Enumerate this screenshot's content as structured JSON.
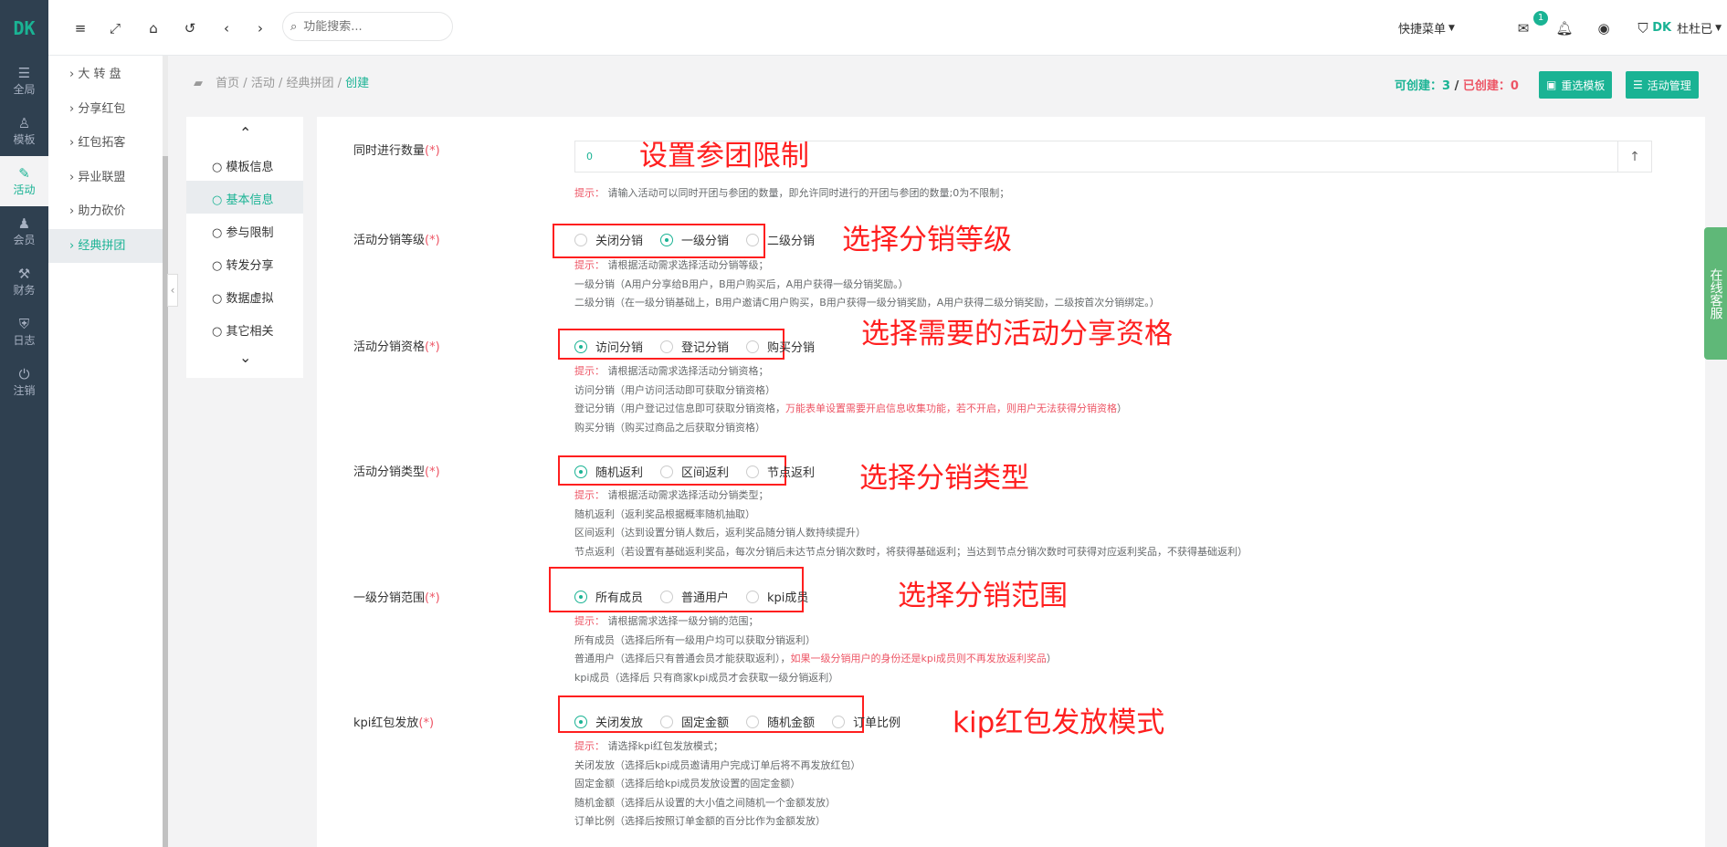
{
  "brand": {
    "logo": "DK",
    "accent": "#1ab394"
  },
  "rail": [
    {
      "label": "全局",
      "icon": "sliders-icon"
    },
    {
      "label": "模板",
      "icon": "sitemap-icon"
    },
    {
      "label": "活动",
      "icon": "pen-icon"
    },
    {
      "label": "会员",
      "icon": "users-icon"
    },
    {
      "label": "财务",
      "icon": "gavel-icon"
    },
    {
      "label": "日志",
      "icon": "shield-icon"
    },
    {
      "label": "注销",
      "icon": "power-icon"
    }
  ],
  "submenu": [
    "大 转 盘",
    "分享红包",
    "红包拓客",
    "异业联盟",
    "助力砍价",
    "经典拼团"
  ],
  "topbar": {
    "search_placeholder": "功能搜索...",
    "quick_menu": "快捷菜单",
    "mail_badge": "1",
    "user": "杜杜已"
  },
  "breadcrumb": {
    "home": "首页",
    "activity": "活动",
    "group": "经典拼团",
    "current": "创建"
  },
  "quota": {
    "can_label": "可创建：",
    "can_value": "3",
    "sep": " / ",
    "done_label": "已创建：",
    "done_value": "0"
  },
  "buttons": {
    "reselect": "重选模板",
    "manage": "活动管理"
  },
  "steps": [
    "模板信息",
    "基本信息",
    "参与限制",
    "转发分享",
    "数据虚拟",
    "其它相关"
  ],
  "form": {
    "concurrent": {
      "label": "同时进行数量",
      "required": "(*)",
      "value": "0",
      "hint": "请输入活动可以同时开团与参团的数量，即允许同时进行的开团与参团的数量;0为不限制；",
      "annotation": "设置参团限制"
    },
    "level": {
      "label": "活动分销等级",
      "required": "(*)",
      "options": [
        "关闭分销",
        "一级分销",
        "二级分销"
      ],
      "annotation": "选择分销等级",
      "hint": "请根据活动需求选择活动分销等级；",
      "lines": [
        "一级分销（A用户分享给B用户，B用户购买后，A用户获得一级分销奖励。）",
        "二级分销（在一级分销基础上，B用户邀请C用户购买，B用户获得一级分销奖励，A用户获得二级分销奖励，二级按首次分销绑定。）"
      ]
    },
    "qualification": {
      "label": "活动分销资格",
      "required": "(*)",
      "options": [
        "访问分销",
        "登记分销",
        "购买分销"
      ],
      "annotation": "选择需要的活动分享资格",
      "hint": "请根据活动需求选择活动分销资格；",
      "line1": "访问分销（用户访问活动即可获取分销资格）",
      "line2a": "登记分销（用户登记过信息即可获取分销资格，",
      "line2b": "万能表单设置需要开启信息收集功能，若不开启，则用户无法获得分销资格",
      "line2c": "）",
      "line3": "购买分销（购买过商品之后获取分销资格）"
    },
    "type": {
      "label": "活动分销类型",
      "required": "(*)",
      "options": [
        "随机返利",
        "区间返利",
        "节点返利"
      ],
      "annotation": "选择分销类型",
      "hint": "请根据活动需求选择活动分销类型；",
      "lines": [
        "随机返利（返利奖品根据概率随机抽取）",
        "区间返利（达到设置分销人数后，返利奖品随分销人数持续提升）",
        "节点返利（若设置有基础返利奖品，每次分销后未达节点分销次数时，将获得基础返利；当达到节点分销次数时可获得对应返利奖品，不获得基础返利）"
      ]
    },
    "scope": {
      "label": "一级分销范围",
      "required": "(*)",
      "options": [
        "所有成员",
        "普通用户",
        "kpi成员"
      ],
      "annotation": "选择分销范围",
      "hint": "请根据需求选择一级分销的范围；",
      "line1": "所有成员（选择后所有一级用户均可以获取分销返利）",
      "line2a": "普通用户（选择后只有普通会员才能获取返利），",
      "line2b": "如果一级分销用户的身份还是kpi成员则不再发放返利奖品",
      "line2c": "）",
      "line3": "kpi成员（选择后 只有商家kpi成员才会获取一级分销返利）"
    },
    "kpi": {
      "label": "kpi红包发放",
      "required": "(*)",
      "options": [
        "关闭发放",
        "固定金额",
        "随机金额",
        "订单比例"
      ],
      "annotation": "kip红包发放模式",
      "hint": "请选择kpi红包发放模式；",
      "lines": [
        "关闭发放（选择后kpi成员邀请用户完成订单后将不再发放红包）",
        "固定金额（选择后给kpi成员发放设置的固定金额）",
        "随机金额（选择后从设置的大小值之间随机一个金额发放）",
        "订单比例（选择后按照订单金额的百分比作为金额发放）"
      ]
    },
    "hint_prefix": "提示："
  },
  "service": "在线客服"
}
